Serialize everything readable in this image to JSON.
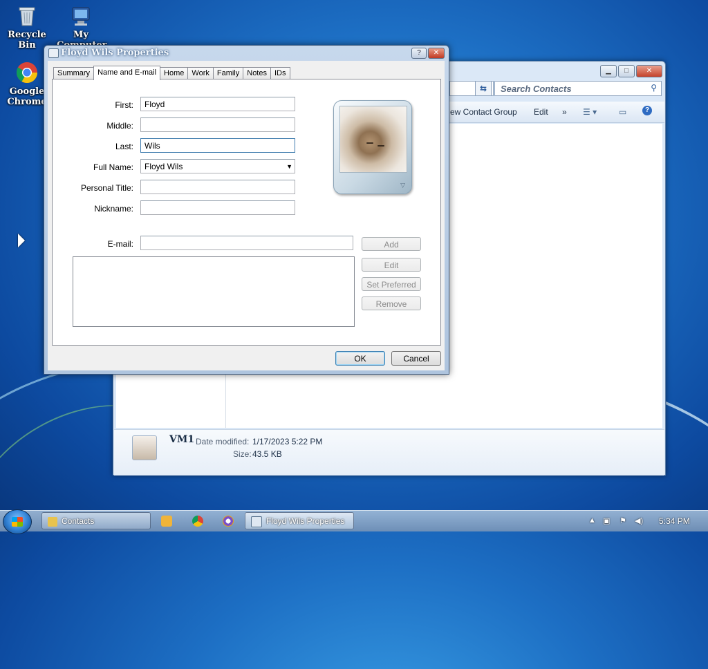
{
  "desktop": {
    "icons": [
      {
        "label_line1": "Recycle",
        "label_line2": "Bin"
      },
      {
        "label_line1": "My",
        "label_line2": "Computer"
      },
      {
        "label_line1": "Google",
        "label_line2": "Chrome"
      }
    ]
  },
  "explorer": {
    "search_placeholder": "Search Contacts",
    "toolbar": {
      "new_contact_group": "ew Contact Group",
      "edit": "Edit",
      "more": "»"
    },
    "details": {
      "name": "VM1",
      "date_modified_label": "Date modified:",
      "date_modified_value": "1/17/2023 5:22 PM",
      "size_label": "Size:",
      "size_value": "43.5 KB"
    }
  },
  "dialog": {
    "title": "Floyd Wils Properties",
    "help_button": "?",
    "close_button": "✕",
    "tabs": [
      {
        "label": "Summary",
        "active": false
      },
      {
        "label": "Name and E-mail",
        "active": true
      },
      {
        "label": "Home",
        "active": false
      },
      {
        "label": "Work",
        "active": false
      },
      {
        "label": "Family",
        "active": false
      },
      {
        "label": "Notes",
        "active": false
      },
      {
        "label": "IDs",
        "active": false
      }
    ],
    "fields": {
      "first_label": "First:",
      "first_value": "Floyd",
      "middle_label": "Middle:",
      "middle_value": "",
      "last_label": "Last:",
      "last_value": "Wils",
      "fullname_label": "Full Name:",
      "fullname_value": "Floyd Wils",
      "personal_title_label": "Personal Title:",
      "personal_title_value": "",
      "nickname_label": "Nickname:",
      "nickname_value": "",
      "email_label": "E-mail:",
      "email_value": ""
    },
    "buttons": {
      "add": "Add",
      "edit": "Edit",
      "set_preferred": "Set Preferred",
      "remove": "Remove",
      "ok": "OK",
      "cancel": "Cancel"
    }
  },
  "taskbar": {
    "contacts": "Contacts",
    "properties": "Floyd Wils Properties",
    "clock": "5:34 PM"
  }
}
